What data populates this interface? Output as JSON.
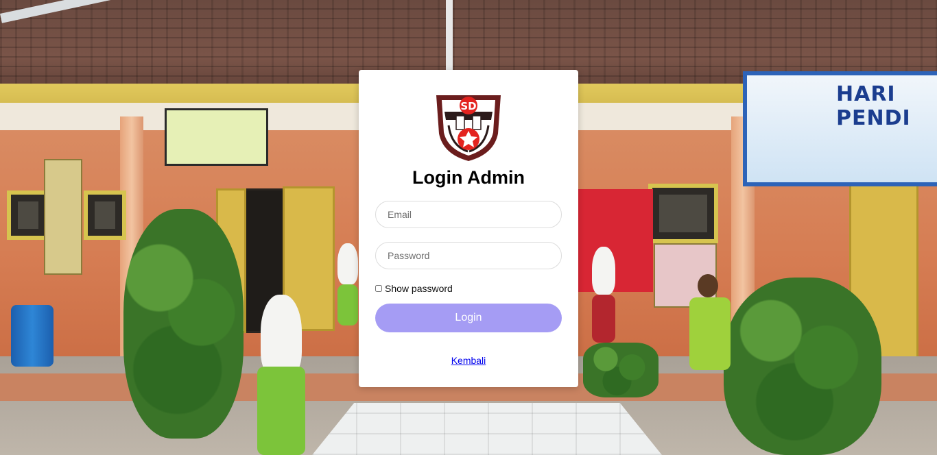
{
  "login": {
    "title": "Login Admin",
    "logo_text": "SD",
    "email_placeholder": "Email",
    "password_placeholder": "Password",
    "show_password_label": "Show password",
    "show_password_checked": false,
    "login_button": "Login",
    "back_link": "Kembali"
  },
  "background": {
    "banner_text": "HARI PENDI"
  },
  "colors": {
    "button": "#a59cf4",
    "link": "#0000ee",
    "card": "#ffffff",
    "logo_shield": "#6b1d1d",
    "logo_accent": "#e3231f"
  }
}
